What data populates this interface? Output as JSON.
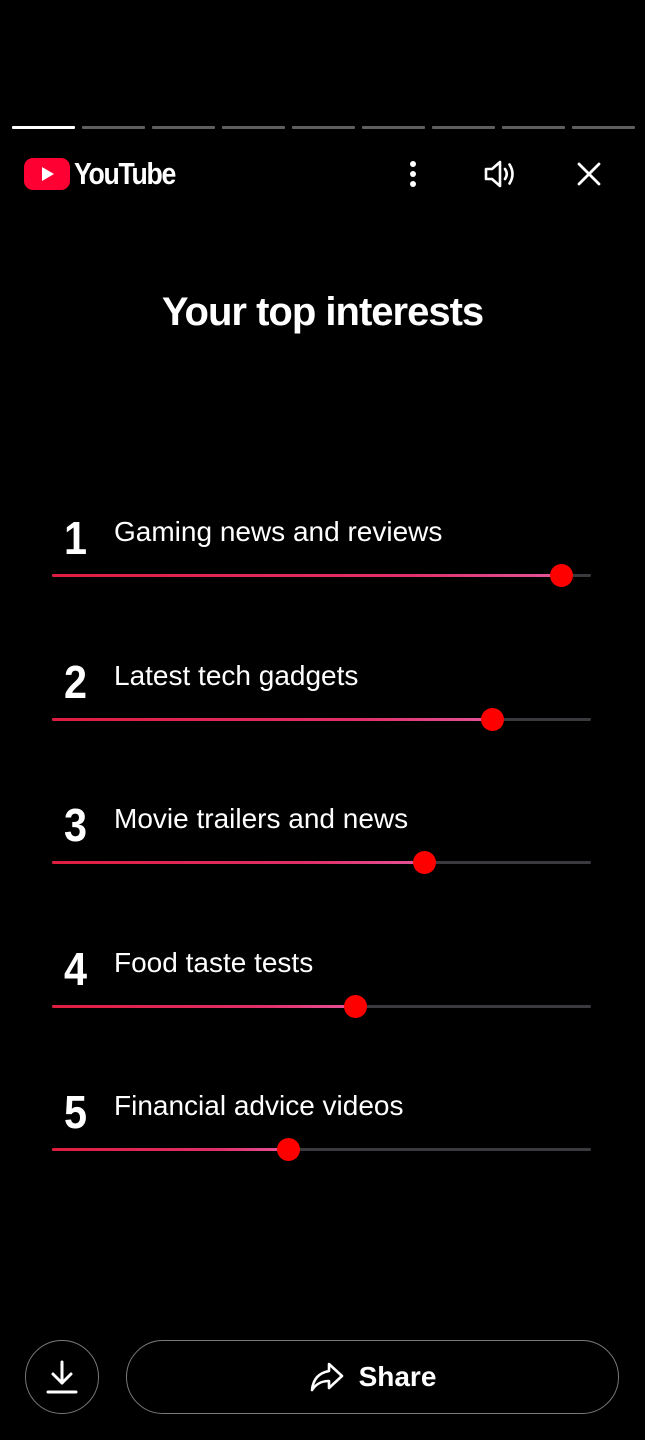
{
  "story": {
    "segments_total": 9,
    "segments_completed": 1
  },
  "header": {
    "logo_text": "YouTube",
    "logo_color": "#ff0033",
    "icons": {
      "more": "more-vert-icon",
      "sound": "volume-icon",
      "close": "close-icon"
    }
  },
  "title": "Your top interests",
  "interests": [
    {
      "rank": "1",
      "label": "Gaming news and reviews",
      "level": 0.946
    },
    {
      "rank": "2",
      "label": "Latest tech gadgets",
      "level": 0.818
    },
    {
      "rank": "3",
      "label": "Movie trailers and news",
      "level": 0.692
    },
    {
      "rank": "4",
      "label": "Food taste tests",
      "level": 0.564
    },
    {
      "rank": "5",
      "label": "Financial advice videos",
      "level": 0.438
    }
  ],
  "colors": {
    "knob": "#ff0000",
    "track": "#3a3a3e",
    "fill_start": "#e01d3f",
    "fill_end": "#e4559a"
  },
  "actions": {
    "download_icon": "download-icon",
    "share_icon": "share-arrow-icon",
    "share_label": "Share"
  }
}
